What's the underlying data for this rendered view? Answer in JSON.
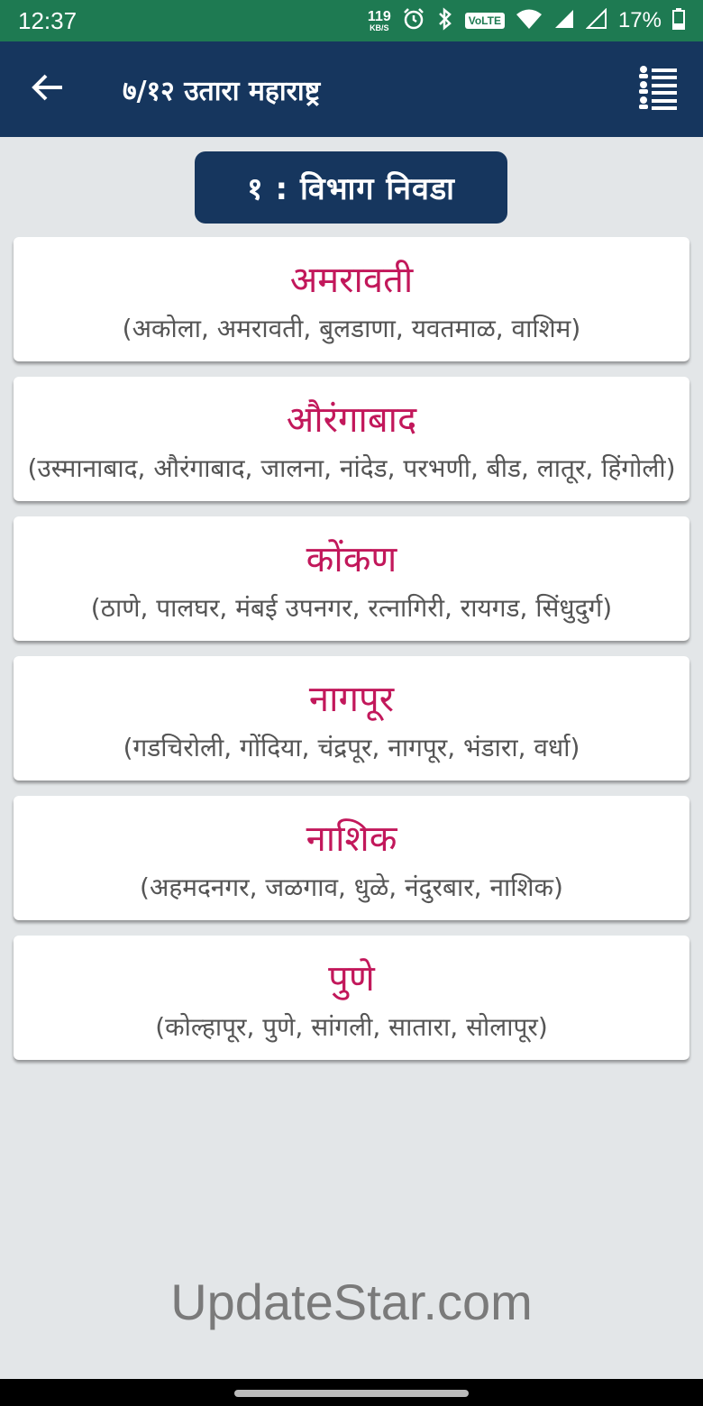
{
  "status_bar": {
    "time": "12:37",
    "net_speed": "119",
    "net_unit": "KB/S",
    "volte": "VoLTE",
    "battery": "17%",
    "icons": [
      "alarm-icon",
      "bluetooth-icon",
      "wifi-icon",
      "signal-icon",
      "battery-icon"
    ]
  },
  "app_bar": {
    "title": "७/१२ उतारा महाराष्ट्र",
    "back_icon": "arrow-left-icon",
    "menu_icon": "user-list-icon"
  },
  "step": {
    "label": "१ :  विभाग  निवडा"
  },
  "divisions": [
    {
      "name": "अमरावती",
      "districts": "(अकोला, अमरावती, बुलडाणा, यवतमाळ, वाशिम)"
    },
    {
      "name": "औरंगाबाद",
      "districts": "(उस्मानाबाद, औरंगाबाद, जालना, नांदेड, परभणी, बीड, लातूर, हिंगोली)"
    },
    {
      "name": "कोंकण",
      "districts": "(ठाणे, पालघर, मंबई उपनगर, रत्नागिरी, रायगड, सिंधुदुर्ग)"
    },
    {
      "name": "नागपूर",
      "districts": "(गडचिरोली, गोंदिया, चंद्रपूर, नागपूर, भंडारा, वर्धा)"
    },
    {
      "name": "नाशिक",
      "districts": "(अहमदनगर, जळगाव, धुळे, नंदुरबार, नाशिक)"
    },
    {
      "name": "पुणे",
      "districts": "(कोल्हापूर, पुणे, सांगली, सातारा, सोलापूर)"
    }
  ],
  "watermark": "UpdateStar.com",
  "colors": {
    "status_bar": "#1e7a52",
    "app_bar": "#16365e",
    "accent_title": "#c2185b",
    "background": "#e3e6e8"
  }
}
